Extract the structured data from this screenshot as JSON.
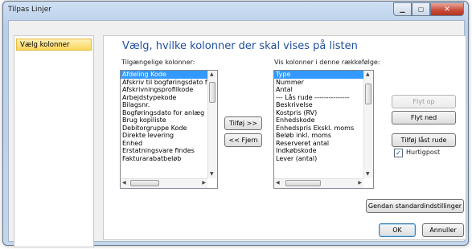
{
  "window": {
    "title": "Tilpas Linjer"
  },
  "sidebar": {
    "items": [
      {
        "label": "Vælg kolonner"
      }
    ]
  },
  "main": {
    "heading": "Vælg, hvilke kolonner der skal vises på listen",
    "available_label": "Tilgængelige kolonner:",
    "shown_label": "Vis kolonner i denne rækkefølge:"
  },
  "available_columns": [
    "Afdeling Kode",
    "Afskriv til bogføringsdato f",
    "Afskrivningsprofilkode",
    "Arbejdstypekode",
    "Bilagsnr.",
    "Bogføringsdato for anlæg",
    "Brug kopiliste",
    "Debitorgruppe Kode",
    "Direkte levering",
    "Enhed",
    "Erstatningsvare findes",
    "Fakturarabatbeløb"
  ],
  "shown_columns": [
    "Type",
    "Nummer",
    "Antal",
    "--- Lås rude ---------------",
    "Beskrivelse",
    "Kostpris (RV)",
    "Enhedskode",
    "Enhedspris Ekskl. moms",
    "Beløb inkl. moms",
    "Reserveret antal",
    "Indkøbskode",
    "Lever (antal)"
  ],
  "buttons": {
    "add": "Tilføj >>",
    "remove": "<< Fjern",
    "move_up": "Flyt op",
    "move_down": "Flyt ned",
    "add_lock": "Tilføj låst rude",
    "restore": "Gendan standardindstillinger",
    "ok": "OK",
    "cancel": "Annuller"
  },
  "checkbox": {
    "label": "Hurtigpost",
    "checked": true
  },
  "icons": {
    "minimize": "minimize-icon",
    "maximize": "maximize-icon",
    "close": "close-icon"
  }
}
